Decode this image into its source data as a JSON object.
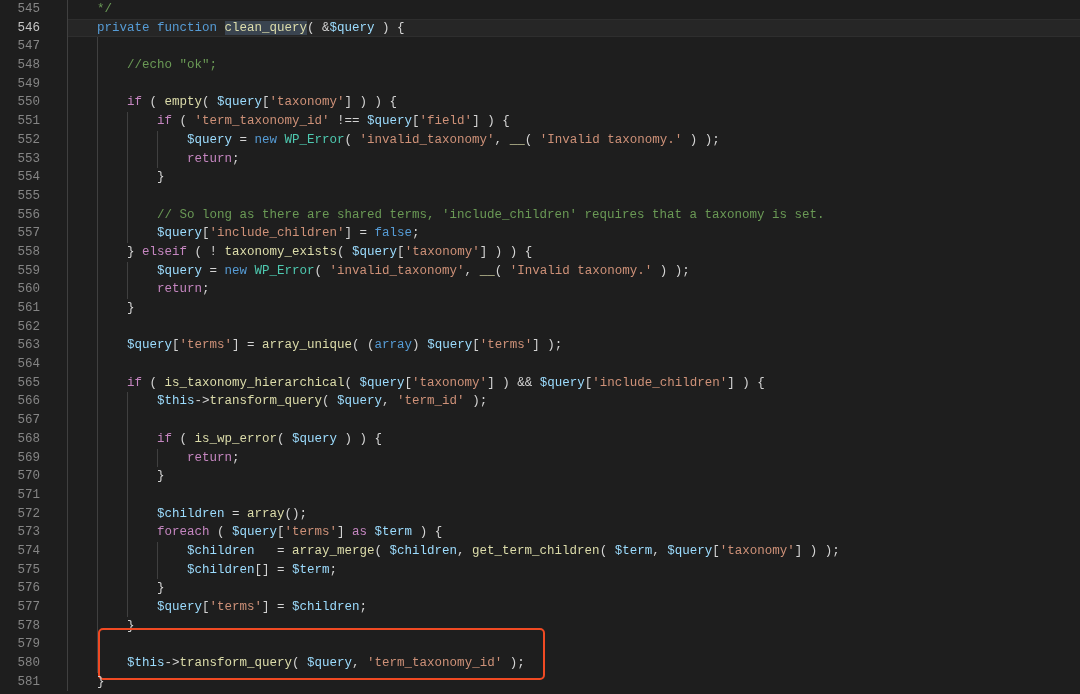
{
  "editor": {
    "lines": [
      {
        "number": "545",
        "current": false,
        "boxed": false,
        "tokens": [
          {
            "kind": "comment",
            "text": "*/"
          }
        ]
      },
      {
        "number": "546",
        "current": true,
        "boxed": false,
        "tokens": [
          {
            "kind": "keyword",
            "text": "private "
          },
          {
            "kind": "keyword",
            "text": "function "
          },
          {
            "kind": "selection",
            "text": "clean_query"
          },
          {
            "kind": "plain",
            "text": "( &"
          },
          {
            "kind": "variable",
            "text": "$query"
          },
          {
            "kind": "plain",
            "text": " ) {"
          }
        ],
        "children": [
          {
            "number": "547",
            "current": false,
            "boxed": false
          },
          {
            "number": "548",
            "current": false,
            "boxed": false,
            "tokens": [
              {
                "kind": "comment",
                "text": "//echo \"ok\";"
              }
            ]
          },
          {
            "number": "549",
            "current": false,
            "boxed": false
          },
          {
            "number": "550",
            "current": false,
            "boxed": false,
            "tokens": [
              {
                "kind": "control",
                "text": "if"
              },
              {
                "kind": "plain",
                "text": " ( "
              },
              {
                "kind": "function",
                "text": "empty"
              },
              {
                "kind": "plain",
                "text": "( "
              },
              {
                "kind": "variable",
                "text": "$query"
              },
              {
                "kind": "plain",
                "text": "["
              },
              {
                "kind": "string",
                "text": "'taxonomy'"
              },
              {
                "kind": "plain",
                "text": "] ) ) {"
              }
            ],
            "children": [
              {
                "number": "551",
                "current": false,
                "boxed": false,
                "tokens": [
                  {
                    "kind": "control",
                    "text": "if"
                  },
                  {
                    "kind": "plain",
                    "text": " ( "
                  },
                  {
                    "kind": "string",
                    "text": "'term_taxonomy_id'"
                  },
                  {
                    "kind": "plain",
                    "text": " !== "
                  },
                  {
                    "kind": "variable",
                    "text": "$query"
                  },
                  {
                    "kind": "plain",
                    "text": "["
                  },
                  {
                    "kind": "string",
                    "text": "'field'"
                  },
                  {
                    "kind": "plain",
                    "text": "] ) {"
                  }
                ],
                "children": [
                  {
                    "number": "552",
                    "current": false,
                    "boxed": false,
                    "tokens": [
                      {
                        "kind": "variable",
                        "text": "$query"
                      },
                      {
                        "kind": "plain",
                        "text": " = "
                      },
                      {
                        "kind": "keyword",
                        "text": "new "
                      },
                      {
                        "kind": "class",
                        "text": "WP_Error"
                      },
                      {
                        "kind": "plain",
                        "text": "( "
                      },
                      {
                        "kind": "string",
                        "text": "'invalid_taxonomy'"
                      },
                      {
                        "kind": "plain",
                        "text": ", "
                      },
                      {
                        "kind": "function",
                        "text": "__"
                      },
                      {
                        "kind": "plain",
                        "text": "( "
                      },
                      {
                        "kind": "string",
                        "text": "'Invalid taxonomy.'"
                      },
                      {
                        "kind": "plain",
                        "text": " ) );"
                      }
                    ]
                  },
                  {
                    "number": "553",
                    "current": false,
                    "boxed": false,
                    "tokens": [
                      {
                        "kind": "control",
                        "text": "return"
                      },
                      {
                        "kind": "plain",
                        "text": ";"
                      }
                    ]
                  }
                ]
              },
              {
                "number": "554",
                "current": false,
                "boxed": false,
                "tokens": [
                  {
                    "kind": "plain",
                    "text": "}"
                  }
                ]
              },
              {
                "number": "555",
                "current": false,
                "boxed": false
              },
              {
                "number": "556",
                "current": false,
                "boxed": false,
                "tokens": [
                  {
                    "kind": "comment",
                    "text": "// So long as there are shared terms, 'include_children' requires that a taxonomy is set."
                  }
                ]
              },
              {
                "number": "557",
                "current": false,
                "boxed": false,
                "tokens": [
                  {
                    "kind": "variable",
                    "text": "$query"
                  },
                  {
                    "kind": "plain",
                    "text": "["
                  },
                  {
                    "kind": "string",
                    "text": "'include_children'"
                  },
                  {
                    "kind": "plain",
                    "text": "] = "
                  },
                  {
                    "kind": "keyword",
                    "text": "false"
                  },
                  {
                    "kind": "plain",
                    "text": ";"
                  }
                ]
              }
            ]
          },
          {
            "number": "558",
            "current": false,
            "boxed": false,
            "tokens": [
              {
                "kind": "plain",
                "text": "} "
              },
              {
                "kind": "control",
                "text": "elseif"
              },
              {
                "kind": "plain",
                "text": " ( ! "
              },
              {
                "kind": "function",
                "text": "taxonomy_exists"
              },
              {
                "kind": "plain",
                "text": "( "
              },
              {
                "kind": "variable",
                "text": "$query"
              },
              {
                "kind": "plain",
                "text": "["
              },
              {
                "kind": "string",
                "text": "'taxonomy'"
              },
              {
                "kind": "plain",
                "text": "] ) ) {"
              }
            ],
            "children": [
              {
                "number": "559",
                "current": false,
                "boxed": false,
                "tokens": [
                  {
                    "kind": "variable",
                    "text": "$query"
                  },
                  {
                    "kind": "plain",
                    "text": " = "
                  },
                  {
                    "kind": "keyword",
                    "text": "new "
                  },
                  {
                    "kind": "class",
                    "text": "WP_Error"
                  },
                  {
                    "kind": "plain",
                    "text": "( "
                  },
                  {
                    "kind": "string",
                    "text": "'invalid_taxonomy'"
                  },
                  {
                    "kind": "plain",
                    "text": ", "
                  },
                  {
                    "kind": "function",
                    "text": "__"
                  },
                  {
                    "kind": "plain",
                    "text": "( "
                  },
                  {
                    "kind": "string",
                    "text": "'Invalid taxonomy.'"
                  },
                  {
                    "kind": "plain",
                    "text": " ) );"
                  }
                ]
              },
              {
                "number": "560",
                "current": false,
                "boxed": false,
                "tokens": [
                  {
                    "kind": "control",
                    "text": "return"
                  },
                  {
                    "kind": "plain",
                    "text": ";"
                  }
                ]
              }
            ]
          },
          {
            "number": "561",
            "current": false,
            "boxed": false,
            "tokens": [
              {
                "kind": "plain",
                "text": "}"
              }
            ]
          },
          {
            "number": "562",
            "current": false,
            "boxed": false
          },
          {
            "number": "563",
            "current": false,
            "boxed": false,
            "tokens": [
              {
                "kind": "variable",
                "text": "$query"
              },
              {
                "kind": "plain",
                "text": "["
              },
              {
                "kind": "string",
                "text": "'terms'"
              },
              {
                "kind": "plain",
                "text": "] = "
              },
              {
                "kind": "function",
                "text": "array_unique"
              },
              {
                "kind": "plain",
                "text": "( ("
              },
              {
                "kind": "keyword",
                "text": "array"
              },
              {
                "kind": "plain",
                "text": ") "
              },
              {
                "kind": "variable",
                "text": "$query"
              },
              {
                "kind": "plain",
                "text": "["
              },
              {
                "kind": "string",
                "text": "'terms'"
              },
              {
                "kind": "plain",
                "text": "] );"
              }
            ]
          },
          {
            "number": "564",
            "current": false,
            "boxed": false
          },
          {
            "number": "565",
            "current": false,
            "boxed": false,
            "tokens": [
              {
                "kind": "control",
                "text": "if"
              },
              {
                "kind": "plain",
                "text": " ( "
              },
              {
                "kind": "function",
                "text": "is_taxonomy_hierarchical"
              },
              {
                "kind": "plain",
                "text": "( "
              },
              {
                "kind": "variable",
                "text": "$query"
              },
              {
                "kind": "plain",
                "text": "["
              },
              {
                "kind": "string",
                "text": "'taxonomy'"
              },
              {
                "kind": "plain",
                "text": "] ) && "
              },
              {
                "kind": "variable",
                "text": "$query"
              },
              {
                "kind": "plain",
                "text": "["
              },
              {
                "kind": "string",
                "text": "'include_children'"
              },
              {
                "kind": "plain",
                "text": "] ) {"
              }
            ],
            "children": [
              {
                "number": "566",
                "current": false,
                "boxed": false,
                "tokens": [
                  {
                    "kind": "variable",
                    "text": "$this"
                  },
                  {
                    "kind": "plain",
                    "text": "->"
                  },
                  {
                    "kind": "function",
                    "text": "transform_query"
                  },
                  {
                    "kind": "plain",
                    "text": "( "
                  },
                  {
                    "kind": "variable",
                    "text": "$query"
                  },
                  {
                    "kind": "plain",
                    "text": ", "
                  },
                  {
                    "kind": "string",
                    "text": "'term_id'"
                  },
                  {
                    "kind": "plain",
                    "text": " );"
                  }
                ]
              },
              {
                "number": "567",
                "current": false,
                "boxed": false
              },
              {
                "number": "568",
                "current": false,
                "boxed": false,
                "tokens": [
                  {
                    "kind": "control",
                    "text": "if"
                  },
                  {
                    "kind": "plain",
                    "text": " ( "
                  },
                  {
                    "kind": "function",
                    "text": "is_wp_error"
                  },
                  {
                    "kind": "plain",
                    "text": "( "
                  },
                  {
                    "kind": "variable",
                    "text": "$query"
                  },
                  {
                    "kind": "plain",
                    "text": " ) ) {"
                  }
                ],
                "children": [
                  {
                    "number": "569",
                    "current": false,
                    "boxed": false,
                    "tokens": [
                      {
                        "kind": "control",
                        "text": "return"
                      },
                      {
                        "kind": "plain",
                        "text": ";"
                      }
                    ]
                  }
                ]
              },
              {
                "number": "570",
                "current": false,
                "boxed": false,
                "tokens": [
                  {
                    "kind": "plain",
                    "text": "}"
                  }
                ]
              },
              {
                "number": "571",
                "current": false,
                "boxed": false
              },
              {
                "number": "572",
                "current": false,
                "boxed": false,
                "tokens": [
                  {
                    "kind": "variable",
                    "text": "$children"
                  },
                  {
                    "kind": "plain",
                    "text": " = "
                  },
                  {
                    "kind": "function",
                    "text": "array"
                  },
                  {
                    "kind": "plain",
                    "text": "();"
                  }
                ]
              },
              {
                "number": "573",
                "current": false,
                "boxed": false,
                "tokens": [
                  {
                    "kind": "control",
                    "text": "foreach"
                  },
                  {
                    "kind": "plain",
                    "text": " ( "
                  },
                  {
                    "kind": "variable",
                    "text": "$query"
                  },
                  {
                    "kind": "plain",
                    "text": "["
                  },
                  {
                    "kind": "string",
                    "text": "'terms'"
                  },
                  {
                    "kind": "plain",
                    "text": "] "
                  },
                  {
                    "kind": "control",
                    "text": "as "
                  },
                  {
                    "kind": "variable",
                    "text": "$term"
                  },
                  {
                    "kind": "plain",
                    "text": " ) {"
                  }
                ],
                "children": [
                  {
                    "number": "574",
                    "current": false,
                    "boxed": false,
                    "tokens": [
                      {
                        "kind": "variable",
                        "text": "$children"
                      },
                      {
                        "kind": "plain",
                        "text": "   = "
                      },
                      {
                        "kind": "function",
                        "text": "array_merge"
                      },
                      {
                        "kind": "plain",
                        "text": "( "
                      },
                      {
                        "kind": "variable",
                        "text": "$children"
                      },
                      {
                        "kind": "plain",
                        "text": ", "
                      },
                      {
                        "kind": "function",
                        "text": "get_term_children"
                      },
                      {
                        "kind": "plain",
                        "text": "( "
                      },
                      {
                        "kind": "variable",
                        "text": "$term"
                      },
                      {
                        "kind": "plain",
                        "text": ", "
                      },
                      {
                        "kind": "variable",
                        "text": "$query"
                      },
                      {
                        "kind": "plain",
                        "text": "["
                      },
                      {
                        "kind": "string",
                        "text": "'taxonomy'"
                      },
                      {
                        "kind": "plain",
                        "text": "] ) );"
                      }
                    ]
                  },
                  {
                    "number": "575",
                    "current": false,
                    "boxed": false,
                    "tokens": [
                      {
                        "kind": "variable",
                        "text": "$children"
                      },
                      {
                        "kind": "plain",
                        "text": "[] = "
                      },
                      {
                        "kind": "variable",
                        "text": "$term"
                      },
                      {
                        "kind": "plain",
                        "text": ";"
                      }
                    ]
                  }
                ]
              },
              {
                "number": "576",
                "current": false,
                "boxed": false,
                "tokens": [
                  {
                    "kind": "plain",
                    "text": "}"
                  }
                ]
              },
              {
                "number": "577",
                "current": false,
                "boxed": false,
                "tokens": [
                  {
                    "kind": "variable",
                    "text": "$query"
                  },
                  {
                    "kind": "plain",
                    "text": "["
                  },
                  {
                    "kind": "string",
                    "text": "'terms'"
                  },
                  {
                    "kind": "plain",
                    "text": "] = "
                  },
                  {
                    "kind": "variable",
                    "text": "$children"
                  },
                  {
                    "kind": "plain",
                    "text": ";"
                  }
                ]
              }
            ]
          },
          {
            "number": "578",
            "current": false,
            "boxed": false,
            "tokens": [
              {
                "kind": "plain",
                "text": "}"
              }
            ]
          },
          {
            "number": "579",
            "current": false,
            "boxed": true
          },
          {
            "number": "580",
            "current": false,
            "boxed": true,
            "tokens": [
              {
                "kind": "variable",
                "text": "$this"
              },
              {
                "kind": "plain",
                "text": "->"
              },
              {
                "kind": "function",
                "text": "transform_query"
              },
              {
                "kind": "plain",
                "text": "( "
              },
              {
                "kind": "variable",
                "text": "$query"
              },
              {
                "kind": "plain",
                "text": ", "
              },
              {
                "kind": "string",
                "text": "'term_taxonomy_id'"
              },
              {
                "kind": "plain",
                "text": " );"
              }
            ]
          }
        ]
      },
      {
        "number": "581",
        "current": false,
        "boxed": false,
        "tokens": [
          {
            "kind": "plain",
            "text": "}"
          }
        ]
      }
    ]
  }
}
